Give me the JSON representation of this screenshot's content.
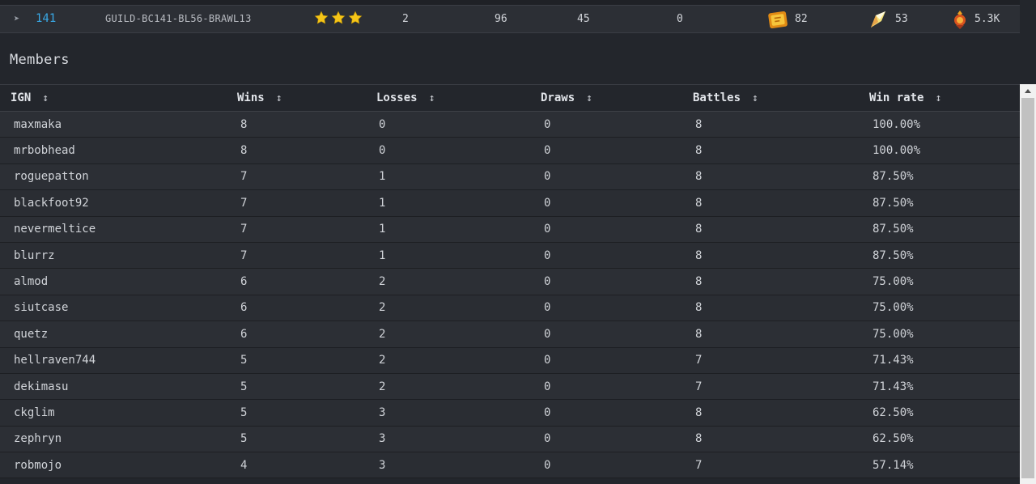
{
  "summary": {
    "round": "141",
    "guild_id": "GUILD-BC141-BL56-BRAWL13",
    "stars": 3,
    "stat_1": "2",
    "stat_2": "96",
    "stat_3": "45",
    "stat_4": "0",
    "resources": [
      {
        "icon": "merits-crate-icon",
        "value": "82"
      },
      {
        "icon": "energy-shard-icon",
        "value": "53"
      },
      {
        "icon": "crown-token-icon",
        "value": "5.3K"
      }
    ],
    "colors": {
      "round_link": "#39a9e6",
      "star": "#f5c518"
    }
  },
  "members": {
    "title": "Members",
    "columns": [
      {
        "label": "IGN",
        "sort_icon": "↕"
      },
      {
        "label": "Wins",
        "sort_icon": "↕"
      },
      {
        "label": "Losses",
        "sort_icon": "↕"
      },
      {
        "label": "Draws",
        "sort_icon": "↕"
      },
      {
        "label": "Battles",
        "sort_icon": "↕"
      },
      {
        "label": "Win rate",
        "sort_icon": "↕"
      }
    ],
    "rows": [
      {
        "ign": "maxmaka",
        "wins": "8",
        "losses": "0",
        "draws": "0",
        "battles": "8",
        "win_rate": "100.00%"
      },
      {
        "ign": "mrbobhead",
        "wins": "8",
        "losses": "0",
        "draws": "0",
        "battles": "8",
        "win_rate": "100.00%"
      },
      {
        "ign": "roguepatton",
        "wins": "7",
        "losses": "1",
        "draws": "0",
        "battles": "8",
        "win_rate": "87.50%"
      },
      {
        "ign": "blackfoot92",
        "wins": "7",
        "losses": "1",
        "draws": "0",
        "battles": "8",
        "win_rate": "87.50%"
      },
      {
        "ign": "nevermeltice",
        "wins": "7",
        "losses": "1",
        "draws": "0",
        "battles": "8",
        "win_rate": "87.50%"
      },
      {
        "ign": "blurrz",
        "wins": "7",
        "losses": "1",
        "draws": "0",
        "battles": "8",
        "win_rate": "87.50%"
      },
      {
        "ign": "almod",
        "wins": "6",
        "losses": "2",
        "draws": "0",
        "battles": "8",
        "win_rate": "75.00%"
      },
      {
        "ign": "siutcase",
        "wins": "6",
        "losses": "2",
        "draws": "0",
        "battles": "8",
        "win_rate": "75.00%"
      },
      {
        "ign": "quetz",
        "wins": "6",
        "losses": "2",
        "draws": "0",
        "battles": "8",
        "win_rate": "75.00%"
      },
      {
        "ign": "hellraven744",
        "wins": "5",
        "losses": "2",
        "draws": "0",
        "battles": "7",
        "win_rate": "71.43%"
      },
      {
        "ign": "dekimasu",
        "wins": "5",
        "losses": "2",
        "draws": "0",
        "battles": "7",
        "win_rate": "71.43%"
      },
      {
        "ign": "ckglim",
        "wins": "5",
        "losses": "3",
        "draws": "0",
        "battles": "8",
        "win_rate": "62.50%"
      },
      {
        "ign": "zephryn",
        "wins": "5",
        "losses": "3",
        "draws": "0",
        "battles": "8",
        "win_rate": "62.50%"
      },
      {
        "ign": "robmojo",
        "wins": "4",
        "losses": "3",
        "draws": "0",
        "battles": "7",
        "win_rate": "57.14%"
      }
    ]
  }
}
